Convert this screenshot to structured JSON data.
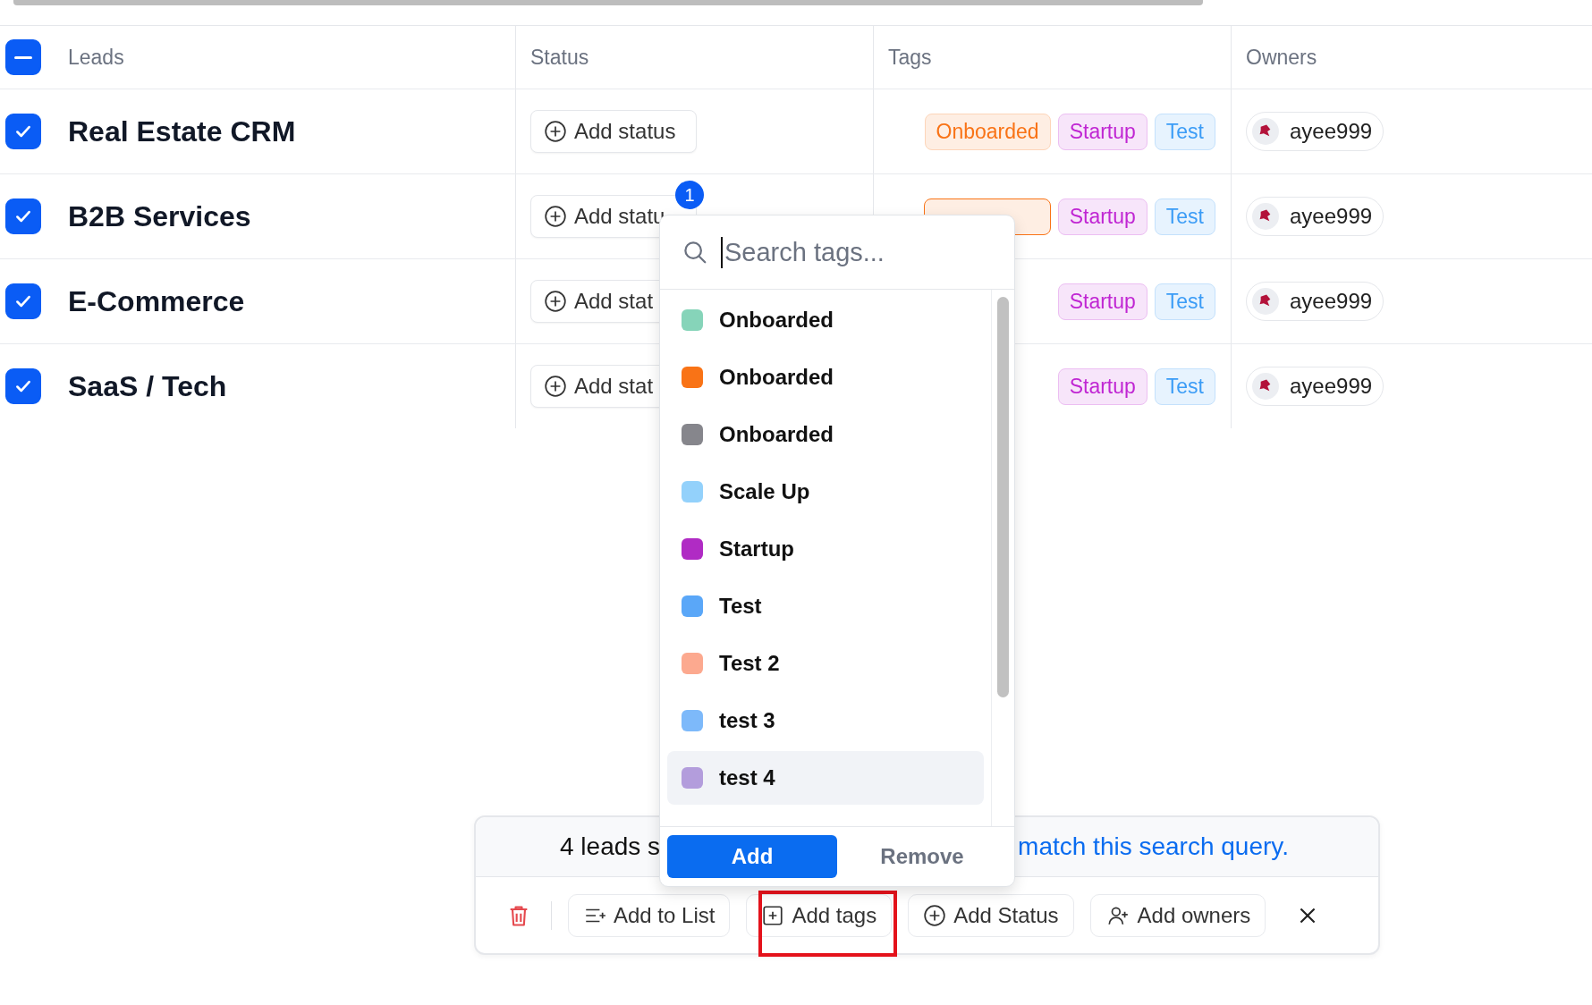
{
  "table": {
    "header_checkbox": {
      "indeterminate": true
    },
    "columns": [
      "Leads",
      "Status",
      "Tags",
      "Owners"
    ],
    "rows": [
      {
        "checked": true,
        "lead": "Real Estate CRM",
        "status_button": "Add status",
        "tags": [
          {
            "label": "Onboarded",
            "color": "#f97316"
          },
          {
            "label": "Startup",
            "color": "#c026d3"
          },
          {
            "label": "Test",
            "color": "#3b9cf6"
          }
        ],
        "owner": "ayee999"
      },
      {
        "checked": true,
        "lead": "B2B Services",
        "status_button": "Add statu",
        "tags": [
          {
            "color": "#f97316"
          },
          {
            "label": "Startup",
            "color": "#c026d3"
          },
          {
            "label": "Test",
            "color": "#3b9cf6"
          }
        ],
        "owner": "ayee999"
      },
      {
        "checked": true,
        "lead": "E-Commerce",
        "status_button": "Add stat",
        "tags": [
          {
            "label": "Startup",
            "color": "#c026d3"
          },
          {
            "label": "Test",
            "color": "#3b9cf6"
          }
        ],
        "owner": "ayee999"
      },
      {
        "checked": true,
        "lead": "SaaS / Tech",
        "status_button": "Add stat",
        "tags": [
          {
            "label": "Startup",
            "color": "#c026d3"
          },
          {
            "label": "Test",
            "color": "#3b9cf6"
          }
        ],
        "owner": "ayee999"
      }
    ]
  },
  "badge": "1",
  "tag_dropdown": {
    "search": {
      "placeholder": "Search tags..."
    },
    "items": [
      {
        "label": "Onboarded",
        "color": "#86d4b9",
        "selected": false
      },
      {
        "label": "Onboarded",
        "color": "#f97316",
        "selected": false
      },
      {
        "label": "Onboarded",
        "color": "#86868c",
        "selected": false
      },
      {
        "label": "Scale Up",
        "color": "#93d1fb",
        "selected": false
      },
      {
        "label": "Startup",
        "color": "#b02bc4",
        "selected": false
      },
      {
        "label": "Test",
        "color": "#5aa7f8",
        "selected": false
      },
      {
        "label": "Test 2",
        "color": "#fca98f",
        "selected": false
      },
      {
        "label": "test 3",
        "color": "#7db9fa",
        "selected": false
      },
      {
        "label": "test 4",
        "color": "#b39ddc",
        "selected": true
      }
    ],
    "add_button": "Add",
    "remove_button": "Remove"
  },
  "bulk_bar": {
    "notice_start": "4 leads s",
    "notice_link": "match this search query.",
    "buttons": [
      {
        "kind": "delete",
        "highlighted": false
      },
      {
        "kind": "list",
        "label": "Add to List",
        "highlighted": false
      },
      {
        "kind": "tags",
        "label": "Add tags",
        "highlighted": true
      },
      {
        "kind": "status",
        "label": "Add Status",
        "highlighted": false
      },
      {
        "kind": "owners",
        "label": "Add owners",
        "highlighted": false
      },
      {
        "kind": "close",
        "highlighted": false
      }
    ]
  }
}
